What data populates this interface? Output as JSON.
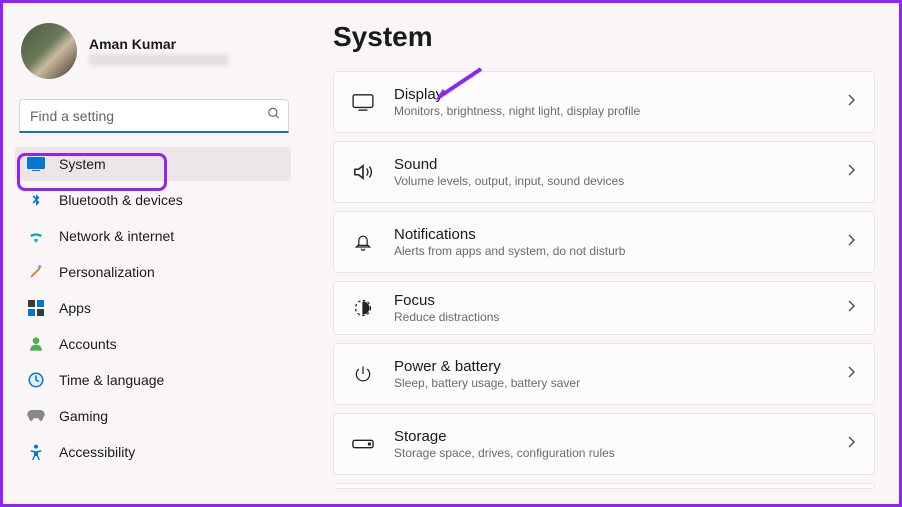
{
  "user": {
    "name": "Aman Kumar"
  },
  "search": {
    "placeholder": "Find a setting"
  },
  "sidebar": {
    "items": [
      {
        "label": "System"
      },
      {
        "label": "Bluetooth & devices"
      },
      {
        "label": "Network & internet"
      },
      {
        "label": "Personalization"
      },
      {
        "label": "Apps"
      },
      {
        "label": "Accounts"
      },
      {
        "label": "Time & language"
      },
      {
        "label": "Gaming"
      },
      {
        "label": "Accessibility"
      }
    ]
  },
  "page": {
    "title": "System"
  },
  "cards": [
    {
      "title": "Display",
      "sub": "Monitors, brightness, night light, display profile"
    },
    {
      "title": "Sound",
      "sub": "Volume levels, output, input, sound devices"
    },
    {
      "title": "Notifications",
      "sub": "Alerts from apps and system, do not disturb"
    },
    {
      "title": "Focus",
      "sub": "Reduce distractions"
    },
    {
      "title": "Power & battery",
      "sub": "Sleep, battery usage, battery saver"
    },
    {
      "title": "Storage",
      "sub": "Storage space, drives, configuration rules"
    }
  ]
}
